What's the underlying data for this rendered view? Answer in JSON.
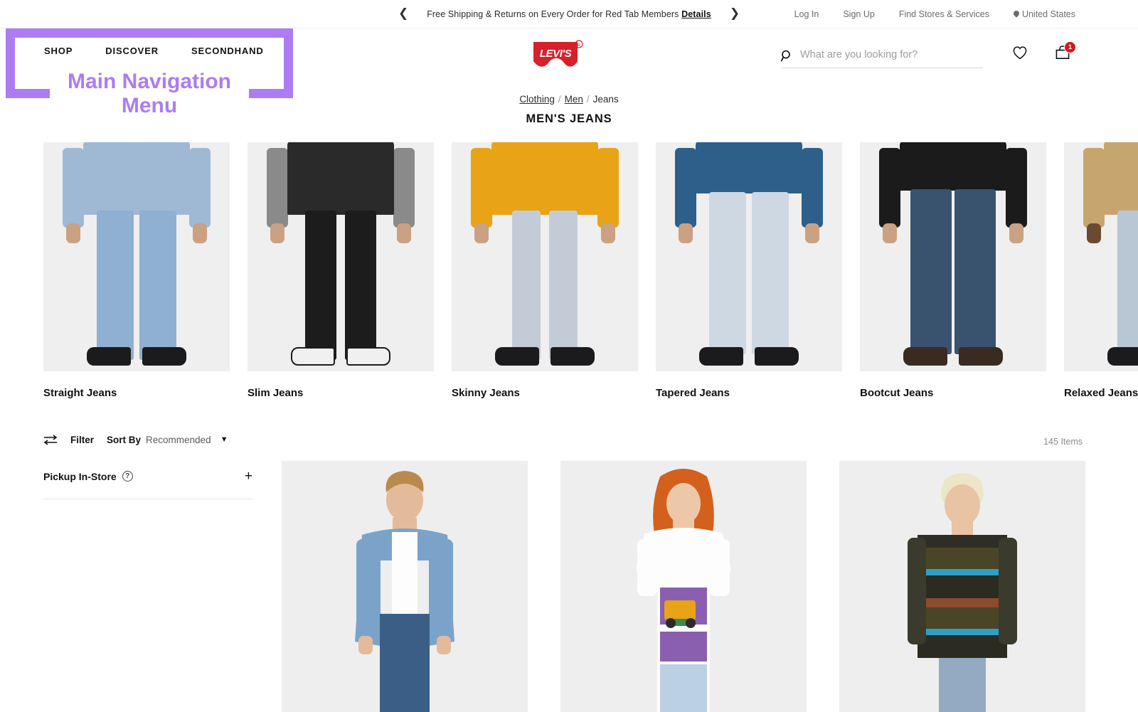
{
  "announcement": {
    "prev_icon": "chevron-left-icon",
    "next_icon": "chevron-right-icon",
    "text": "Free Shipping & Returns on Every Order for Red Tab Members",
    "details_label": "Details"
  },
  "utility": {
    "log_in": "Log In",
    "sign_up": "Sign Up",
    "find_stores": "Find Stores & Services",
    "country": "United States",
    "country_icon": "location-pin-icon"
  },
  "header": {
    "logo_alt": "Levi's",
    "nav": [
      {
        "label": "SHOP"
      },
      {
        "label": "DISCOVER"
      },
      {
        "label": "SECONDHAND"
      }
    ],
    "search": {
      "icon": "search-icon",
      "placeholder": "What are you looking for?",
      "value": ""
    },
    "wishlist_icon": "heart-icon",
    "bag_icon": "shopping-bag-icon",
    "bag_count": "1",
    "badge_color": "#d11b1b"
  },
  "annotation": {
    "label_line1": "Main Navigation",
    "label_line2": "Menu",
    "color": "#ad7cf2"
  },
  "breadcrumb": {
    "items": [
      {
        "label": "Clothing",
        "link": true
      },
      {
        "label": "Men",
        "link": true
      },
      {
        "label": "Jeans",
        "link": false
      }
    ],
    "separator": "/"
  },
  "page_title": "MEN'S JEANS",
  "categories": [
    {
      "label": "Straight Jeans",
      "top": "#9fb8d4",
      "jean": "#8fb0d0",
      "bg": "#efefef"
    },
    {
      "label": "Slim Jeans",
      "top": "#8a8a8a",
      "jean": "#1c1c1c",
      "bg": "#efefef"
    },
    {
      "label": "Skinny Jeans",
      "top": "#e8a317",
      "jean": "#c3ccd6",
      "bg": "#efefef"
    },
    {
      "label": "Tapered Jeans",
      "top": "#2d5f8a",
      "jean": "#cdd8e2",
      "bg": "#efefef"
    },
    {
      "label": "Bootcut Jeans",
      "top": "#1b1b1b",
      "jean": "#39536f",
      "bg": "#efefef"
    },
    {
      "label": "Relaxed Jeans",
      "top": "#c6a66e",
      "jean": "#b9c6d3",
      "bg": "#efefef"
    }
  ],
  "toolbar": {
    "filter_icon": "filter-sliders-icon",
    "filter_label": "Filter",
    "sort_label": "Sort By",
    "sort_value": "Recommended",
    "sort_chevron": "chevron-down-icon",
    "items_count": "145 Items"
  },
  "facets": [
    {
      "label": "Pickup In-Store",
      "help_icon": "question-mark-icon",
      "help_glyph": "?",
      "expand_icon": "plus-icon",
      "expand_glyph": "+"
    }
  ],
  "products": [
    {
      "top": "#7ba3c9",
      "jean": "#3a5e86",
      "hair": "#b98a4e",
      "bg": "#eeeeee"
    },
    {
      "top": "#ffffff",
      "jean": "#bcd0e4",
      "hair": "#d4601e",
      "bg": "#eeeeee"
    },
    {
      "top": "#4a4526",
      "jean": "#93aac2",
      "hair": "#ece6c8",
      "bg": "#eeeeee"
    }
  ]
}
